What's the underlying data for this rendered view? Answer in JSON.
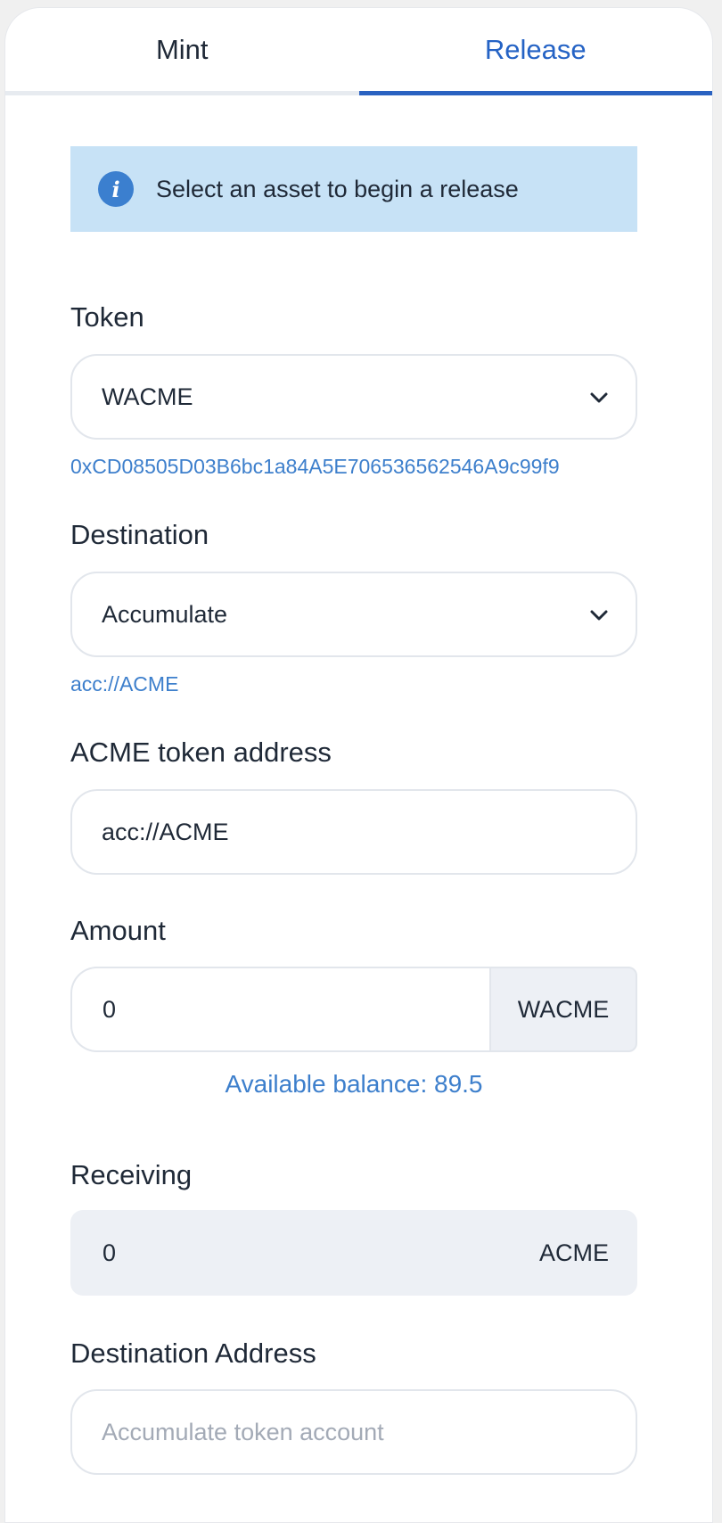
{
  "tabs": {
    "mint": "Mint",
    "release": "Release",
    "active": "Release"
  },
  "alert": {
    "icon": "info-icon",
    "text": "Select an asset to begin a release"
  },
  "token": {
    "label": "Token",
    "selected": "WACME",
    "contract_address": "0xCD08505D03B6bc1a84A5E706536562546A9c99f9"
  },
  "destination": {
    "label": "Destination",
    "selected": "Accumulate",
    "hint": "acc://ACME"
  },
  "acme_token_address": {
    "label": "ACME token address",
    "value": "acc://ACME"
  },
  "amount": {
    "label": "Amount",
    "value": "0",
    "unit": "WACME",
    "available_balance": "Available balance: 89.5"
  },
  "receiving": {
    "label": "Receiving",
    "value": "0",
    "unit": "ACME"
  },
  "destination_address": {
    "label": "Destination Address",
    "placeholder": "Accumulate token account"
  },
  "colors": {
    "accent": "#2a62c1",
    "link": "#3d7fcc",
    "alert_bg": "#c7e2f6"
  }
}
